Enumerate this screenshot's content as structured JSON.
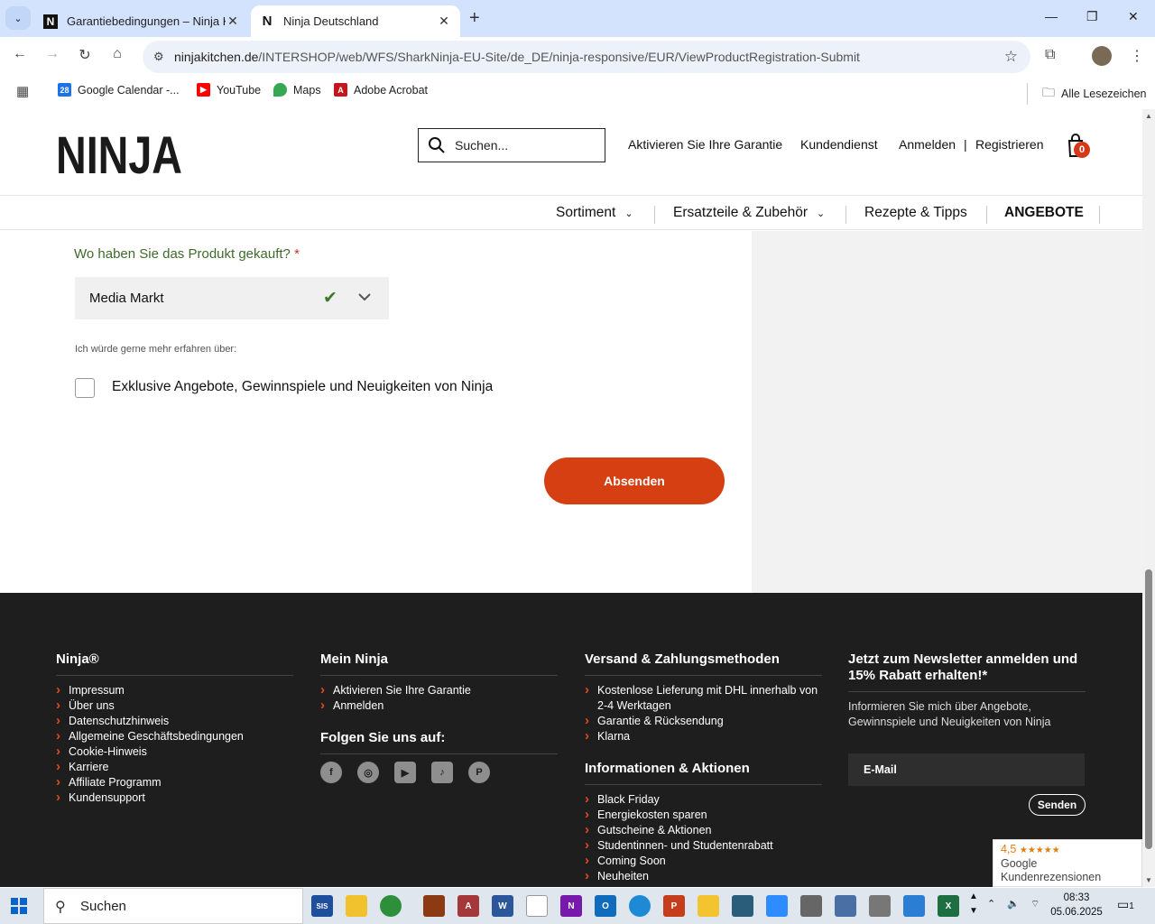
{
  "browser": {
    "tabs": [
      {
        "title": "Garantiebedingungen – Ninja K",
        "active": false
      },
      {
        "title": "Ninja Deutschland",
        "active": true
      }
    ],
    "url_host": "ninjakitchen.de",
    "url_path": "/INTERSHOP/web/WFS/SharkNinja-EU-Site/de_DE/ninja-responsive/EUR/ViewProductRegistration-Submit",
    "bookmarks": [
      "Google Calendar -...",
      "YouTube",
      "Maps",
      "Adobe Acrobat"
    ],
    "all_bookmarks": "Alle Lesezeichen"
  },
  "header": {
    "logo": "NINJA",
    "search_placeholder": "Suchen...",
    "links": [
      "Aktivieren Sie Ihre Garantie",
      "Kundendienst",
      "Anmelden",
      "|",
      "Registrieren"
    ],
    "cart_count": "0"
  },
  "nav": [
    "Sortiment",
    "Ersatzteile & Zubehör",
    "Rezepte & Tipps",
    "ANGEBOTE"
  ],
  "form": {
    "question": "Wo haben Sie das Produkt gekauft?",
    "required_mark": "*",
    "selected_store": "Media Markt",
    "learn_more": "Ich würde gerne mehr erfahren über:",
    "checkbox_label": "Exklusive Angebote, Gewinnspiele und Neuigkeiten von Ninja",
    "checkbox_checked": false,
    "submit_label": "Absenden"
  },
  "footer": {
    "col1": {
      "heading": "Ninja®",
      "items": [
        "Impressum",
        "Über uns",
        "Datenschutzhinweis",
        "Allgemeine Geschäftsbedingungen",
        "Cookie-Hinweis",
        "Karriere",
        "Affiliate Programm",
        "Kundensupport"
      ]
    },
    "col2": {
      "heading": "Mein Ninja",
      "items": [
        "Aktivieren Sie Ihre Garantie",
        "Anmelden"
      ],
      "follow_heading": "Folgen Sie uns auf:",
      "social": [
        "facebook-icon",
        "instagram-icon",
        "youtube-icon",
        "tiktok-icon",
        "pinterest-icon"
      ]
    },
    "col3": {
      "heading": "Versand & Zahlungsmethoden",
      "items": [
        "Kostenlose Lieferung mit DHL innerhalb von 2-4 Werktagen",
        "Garantie & Rücksendung",
        "Klarna"
      ],
      "heading2": "Informationen & Aktionen",
      "items2": [
        "Black Friday",
        "Energiekosten sparen",
        "Gutscheine & Aktionen",
        "Studentinnen- und Studentenrabatt",
        "Coming Soon",
        "Neuheiten"
      ]
    },
    "col4": {
      "heading": "Jetzt zum Newsletter anmelden und 15% Rabatt erhalten!*",
      "text": "Informieren Sie mich über Angebote, Gewinnspiele und Neuigkeiten von Ninja",
      "email_placeholder": "E-Mail",
      "send_label": "Senden"
    }
  },
  "reviews": {
    "rating": "4,5",
    "line1": "Google",
    "line2": "Kundenrezensionen"
  },
  "taskbar": {
    "search": "Suchen",
    "time": "08:33",
    "date": "05.06.2025",
    "notifications": "1"
  }
}
